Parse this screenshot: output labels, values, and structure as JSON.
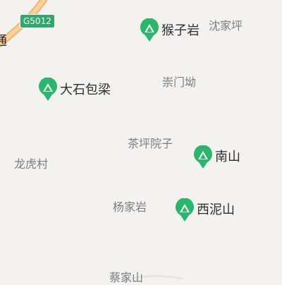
{
  "map": {
    "road_shield": "G5012",
    "edge_label": "通",
    "places": [
      {
        "id": "shenjiaping",
        "name": "沈家坪"
      },
      {
        "id": "chongmenao",
        "name": "崇门坳"
      },
      {
        "id": "chapingyuanzi",
        "name": "茶坪院子"
      },
      {
        "id": "longhucun",
        "name": "龙虎村"
      },
      {
        "id": "yangjiayan",
        "name": "杨家岩"
      },
      {
        "id": "caijiashan",
        "name": "蔡家山"
      }
    ],
    "peaks": [
      {
        "id": "houziyan",
        "name": "猴子岩",
        "icon": "mountain-pin-icon"
      },
      {
        "id": "dashibaoliang",
        "name": "大石包梁",
        "icon": "mountain-pin-icon"
      },
      {
        "id": "nanshan",
        "name": "南山",
        "icon": "mountain-pin-icon"
      },
      {
        "id": "xinishan",
        "name": "西泥山",
        "icon": "mountain-pin-icon"
      }
    ],
    "colors": {
      "background": "#f3f2ef",
      "highway": "#f2b36a",
      "poi_green": "#27b86b",
      "label_gray": "#7a7f86",
      "label_dark": "#2b2f33"
    }
  }
}
